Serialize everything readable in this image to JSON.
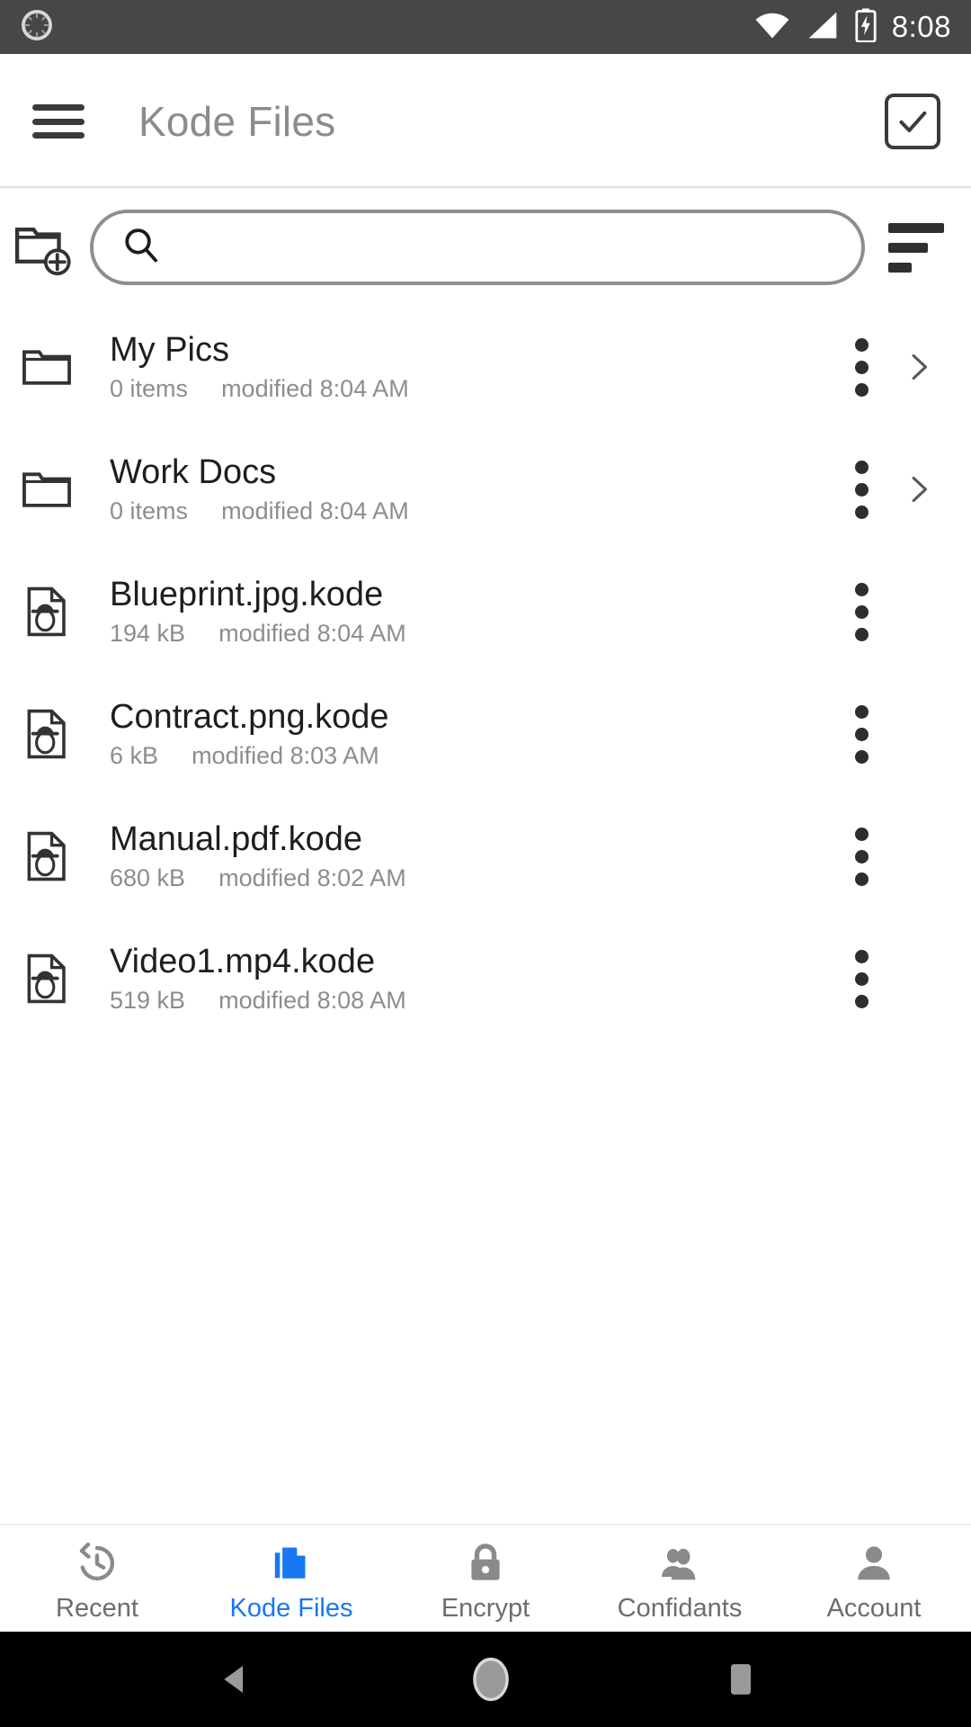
{
  "status_bar": {
    "time": "8:08",
    "icons": [
      "app-progress-icon",
      "wifi-icon",
      "cell-signal-icon",
      "battery-charging-icon"
    ],
    "background": "#474747"
  },
  "app_bar": {
    "title": "Kode Files",
    "menu_icon": "hamburger-menu-icon",
    "select_icon": "select-all-checkbox-icon",
    "title_color": "#8c8c8c"
  },
  "toolbar": {
    "new_folder_icon": "new-folder-icon",
    "search_icon": "search-icon",
    "search_value": "",
    "search_placeholder": "",
    "sort_icon": "sort-icon"
  },
  "list": {
    "items": [
      {
        "name": "My Pics",
        "meta_primary": "0 items",
        "meta_secondary": "modified 8:04 AM",
        "kind": "folder",
        "icon": "folder-icon",
        "has_chevron": true
      },
      {
        "name": "Work Docs",
        "meta_primary": "0 items",
        "meta_secondary": "modified 8:04 AM",
        "kind": "folder",
        "icon": "folder-icon",
        "has_chevron": true
      },
      {
        "name": "Blueprint.jpg.kode",
        "meta_primary": "194 kB",
        "meta_secondary": "modified 8:04 AM",
        "kind": "file",
        "icon": "encrypted-file-icon",
        "has_chevron": false
      },
      {
        "name": "Contract.png.kode",
        "meta_primary": "6 kB",
        "meta_secondary": "modified 8:03 AM",
        "kind": "file",
        "icon": "encrypted-file-icon",
        "has_chevron": false
      },
      {
        "name": "Manual.pdf.kode",
        "meta_primary": "680 kB",
        "meta_secondary": "modified 8:02 AM",
        "kind": "file",
        "icon": "encrypted-file-icon",
        "has_chevron": false
      },
      {
        "name": "Video1.mp4.kode",
        "meta_primary": "519 kB",
        "meta_secondary": "modified 8:08 AM",
        "kind": "file",
        "icon": "encrypted-file-icon",
        "has_chevron": false
      }
    ],
    "row_menu_icon": "overflow-menu-icon",
    "row_chevron_icon": "chevron-right-icon"
  },
  "bottom_nav": {
    "active_color": "#1877f2",
    "inactive_color": "#6d6d6d",
    "items": [
      {
        "label": "Recent",
        "icon": "history-clock-icon",
        "active": false
      },
      {
        "label": "Kode Files",
        "icon": "documents-stack-icon",
        "active": true
      },
      {
        "label": "Encrypt",
        "icon": "lock-icon",
        "active": false
      },
      {
        "label": "Confidants",
        "icon": "people-icon",
        "active": false
      },
      {
        "label": "Account",
        "icon": "person-icon",
        "active": false
      }
    ]
  },
  "android_nav": {
    "back_icon": "android-back-icon",
    "home_icon": "android-home-icon",
    "recents_icon": "android-recents-icon",
    "background": "#000000"
  }
}
